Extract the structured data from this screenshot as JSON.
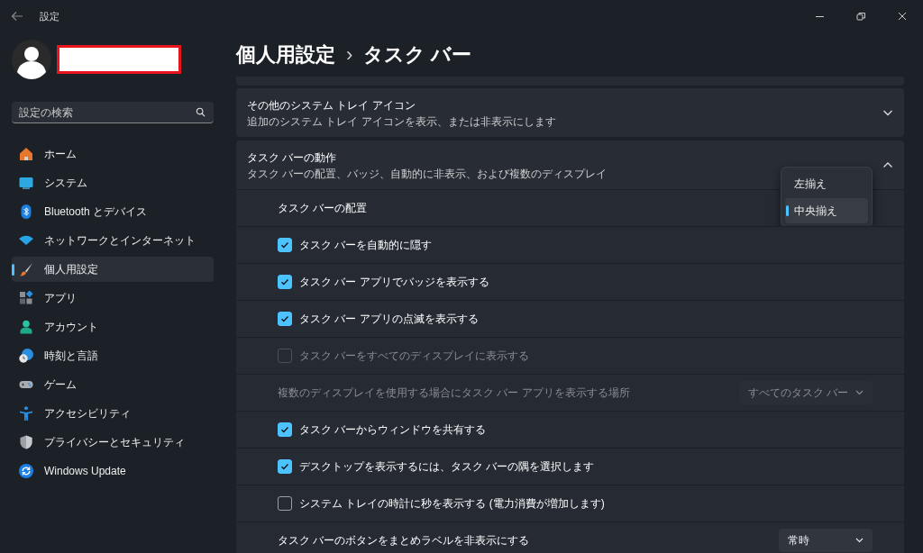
{
  "window": {
    "title": "設定"
  },
  "account": {
    "name_redacted": true
  },
  "search": {
    "placeholder": "設定の検索"
  },
  "sidebar": {
    "items": [
      {
        "label": "ホーム",
        "selected": false
      },
      {
        "label": "システム",
        "selected": false
      },
      {
        "label": "Bluetooth とデバイス",
        "selected": false
      },
      {
        "label": "ネットワークとインターネット",
        "selected": false
      },
      {
        "label": "個人用設定",
        "selected": true
      },
      {
        "label": "アプリ",
        "selected": false
      },
      {
        "label": "アカウント",
        "selected": false
      },
      {
        "label": "時刻と言語",
        "selected": false
      },
      {
        "label": "ゲーム",
        "selected": false
      },
      {
        "label": "アクセシビリティ",
        "selected": false
      },
      {
        "label": "プライバシーとセキュリティ",
        "selected": false
      },
      {
        "label": "Windows Update",
        "selected": false
      }
    ]
  },
  "breadcrumb": {
    "parent": "個人用設定",
    "separator": "›",
    "current": "タスク バー"
  },
  "sections": [
    {
      "title": "その他のシステム トレイ アイコン",
      "description": "追加のシステム トレイ アイコンを表示、または非表示にします",
      "expanded": false
    },
    {
      "title": "タスク バーの動作",
      "description": "タスク バーの配置、バッジ、自動的に非表示、および複数のディスプレイ",
      "expanded": true,
      "rows": [
        {
          "kind": "select",
          "label": "タスク バーの配置",
          "disabled": false,
          "popup": [
            {
              "label": "左揃え",
              "selected": false
            },
            {
              "label": "中央揃え",
              "selected": true
            }
          ]
        },
        {
          "kind": "checkbox",
          "label": "タスク バーを自動的に隠す",
          "checked": true,
          "disabled": false
        },
        {
          "kind": "checkbox",
          "label": "タスク バー アプリでバッジを表示する",
          "checked": true,
          "disabled": false
        },
        {
          "kind": "checkbox",
          "label": "タスク バー アプリの点滅を表示する",
          "checked": true,
          "disabled": false
        },
        {
          "kind": "checkbox",
          "label": "タスク バーをすべてのディスプレイに表示する",
          "checked": false,
          "disabled": true
        },
        {
          "kind": "select",
          "label": "複数のディスプレイを使用する場合にタスク バー アプリを表示する場所",
          "value": "すべてのタスク バー",
          "disabled": true
        },
        {
          "kind": "checkbox",
          "label": "タスク バーからウィンドウを共有する",
          "checked": true,
          "disabled": false
        },
        {
          "kind": "checkbox",
          "label": "デスクトップを表示するには、タスク バーの隅を選択します",
          "checked": true,
          "disabled": false
        },
        {
          "kind": "checkbox",
          "label": "システム トレイの時計に秒を表示する (電力消費が増加します)",
          "checked": false,
          "disabled": false
        },
        {
          "kind": "select",
          "label": "タスク バーのボタンをまとめラベルを非表示にする",
          "value": "常時",
          "disabled": false
        }
      ]
    }
  ]
}
